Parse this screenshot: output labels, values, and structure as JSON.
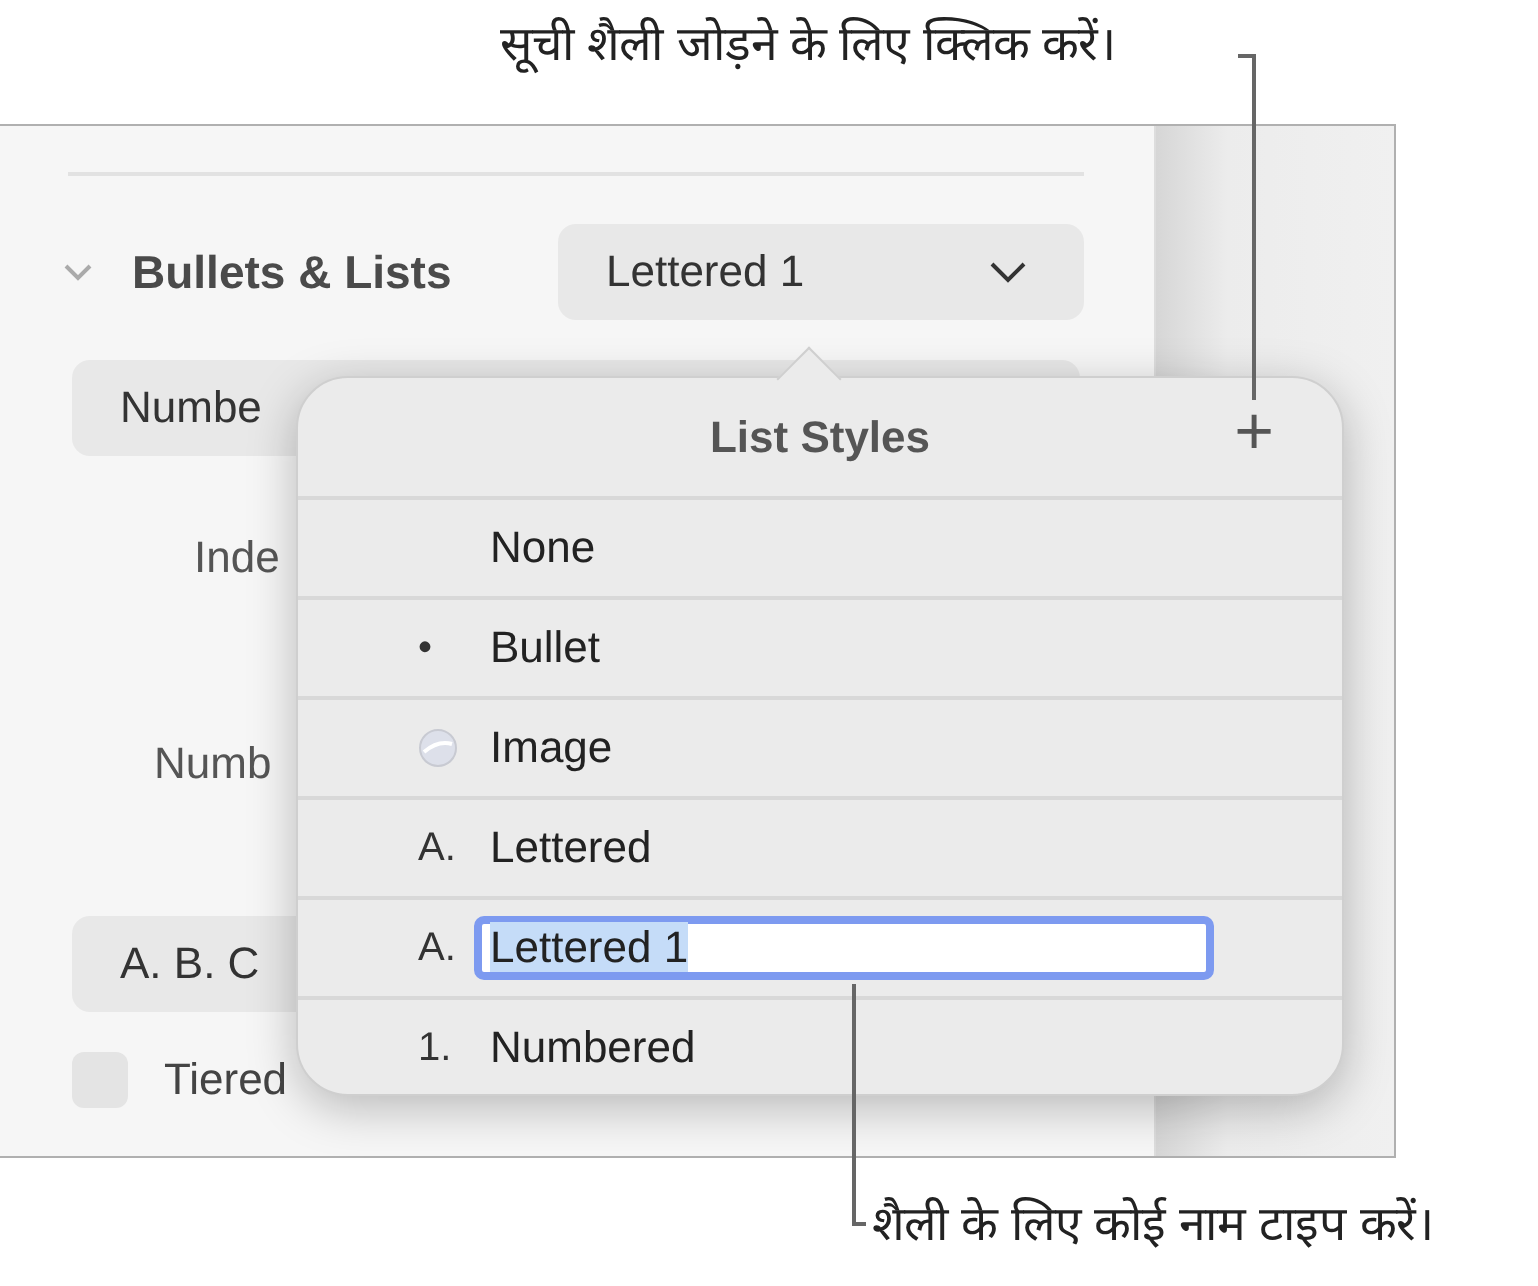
{
  "callouts": [
    {
      "kind": "top",
      "text": "सूची शैली जोड़ने के लिए क्लिक करें।"
    },
    {
      "kind": "bottom",
      "text": "शैली के लिए कोई नाम टाइप करें।"
    }
  ],
  "inspector": {
    "section": {
      "title": "Bullets & Lists",
      "expanded": true,
      "dropdown": "Lettered 1"
    },
    "style_pill": "Numbe",
    "indent_label": "Inde",
    "number_label": "Numb",
    "format_pill": "A. B. C",
    "tiered": {
      "label": "Tiered",
      "checked": false
    }
  },
  "popover": {
    "title": "List Styles",
    "add_button": "+",
    "items": [
      {
        "kind": "text",
        "label": "None",
        "editing": false
      },
      {
        "kind": "text",
        "marker": "•",
        "label": "Bullet",
        "editing": false
      },
      {
        "kind": "image",
        "label": "Image",
        "editing": false
      },
      {
        "kind": "text",
        "marker": "A.",
        "label": "Lettered",
        "editing": false
      },
      {
        "kind": "text",
        "marker": "A.",
        "label": "Lettered 1",
        "editing": true
      },
      {
        "kind": "text",
        "marker": "1.",
        "label": "Numbered",
        "editing": false
      }
    ]
  }
}
